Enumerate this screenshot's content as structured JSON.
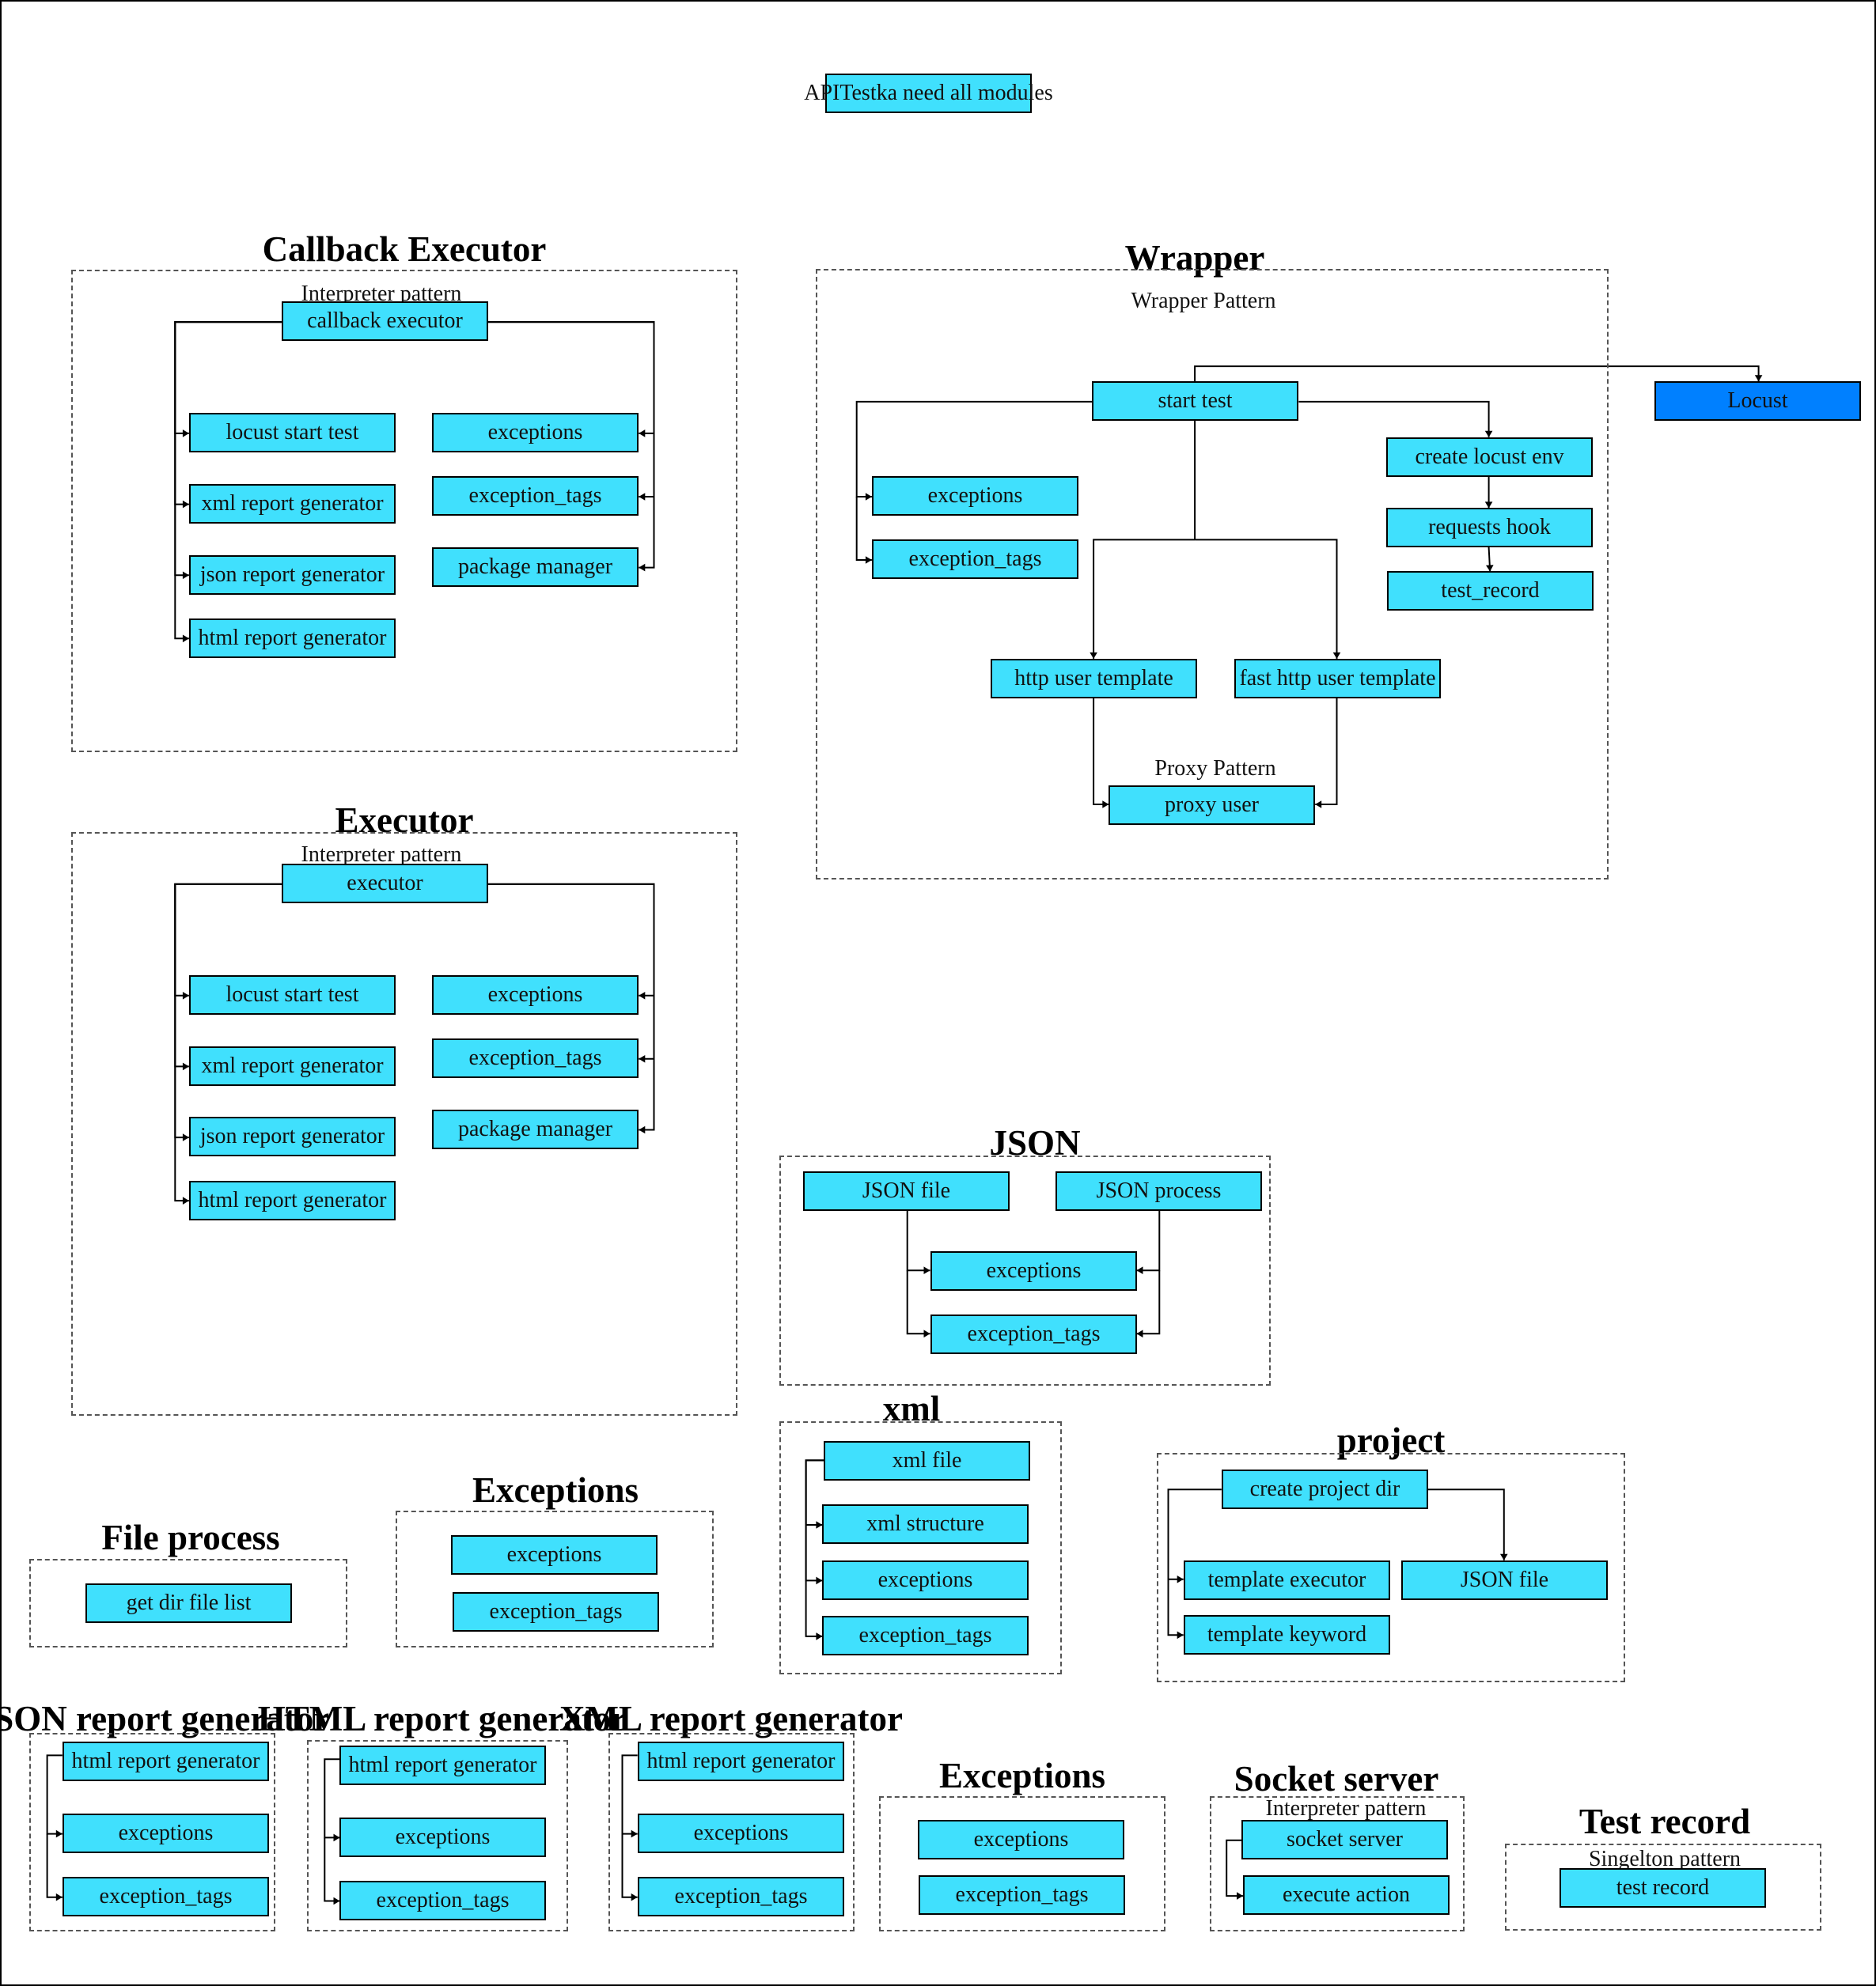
{
  "diagram": {
    "root_node": "APITestka need all modules",
    "colors": {
      "node_fill": "#40e0fd",
      "locust_fill": "#0080ff",
      "border": "#000000",
      "group_border": "#555555"
    },
    "sections": {
      "callback_executor": {
        "title": "Callback Executor",
        "pattern": "Interpreter pattern",
        "root": "callback executor",
        "left_children": [
          "locust start test",
          "xml report generator",
          "json report generator",
          "html report generator"
        ],
        "right_children": [
          "exceptions",
          "exception_tags",
          "package manager"
        ]
      },
      "wrapper": {
        "title": "Wrapper",
        "pattern": "Wrapper Pattern",
        "root": "start test",
        "external": "Locust",
        "left_children": [
          "exceptions",
          "exception_tags"
        ],
        "chain": [
          "create locust env",
          "requests hook",
          "test_record"
        ],
        "templates": [
          "http user template",
          "fast http user template"
        ],
        "proxy_pattern": "Proxy Pattern",
        "proxy": "proxy user"
      },
      "executor": {
        "title": "Executor",
        "pattern": "Interpreter pattern",
        "root": "executor",
        "left_children": [
          "locust start test",
          "xml report generator",
          "json report generator",
          "html report generator"
        ],
        "right_children": [
          "exceptions",
          "exception_tags",
          "package manager"
        ]
      },
      "json": {
        "title": "JSON",
        "sources": [
          "JSON file",
          "JSON process"
        ],
        "children": [
          "exceptions",
          "exception_tags"
        ]
      },
      "xml": {
        "title": "xml",
        "root": "xml file",
        "children": [
          "xml structure",
          "exceptions",
          "exception_tags"
        ]
      },
      "project": {
        "title": "project",
        "root": "create project dir",
        "left_children": [
          "template executor",
          "template keyword"
        ],
        "right_child": "JSON file"
      },
      "file_process": {
        "title": "File process",
        "items": [
          "get dir file list"
        ]
      },
      "exceptions_a": {
        "title": "Exceptions",
        "items": [
          "exceptions",
          "exception_tags"
        ]
      },
      "json_report": {
        "title": "JSON report generator",
        "root": "html report generator",
        "children": [
          "exceptions",
          "exception_tags"
        ]
      },
      "html_report": {
        "title": "HTML report generator",
        "root": "html report generator",
        "children": [
          "exceptions",
          "exception_tags"
        ]
      },
      "xml_report": {
        "title": "XML report generator",
        "root": "html report generator",
        "children": [
          "exceptions",
          "exception_tags"
        ]
      },
      "exceptions_b": {
        "title": "Exceptions",
        "items": [
          "exceptions",
          "exception_tags"
        ]
      },
      "socket_server": {
        "title": "Socket server",
        "pattern": "Interpreter pattern",
        "root": "socket server",
        "children": [
          "execute action"
        ]
      },
      "test_record": {
        "title": "Test record",
        "pattern": "Singelton pattern",
        "items": [
          "test record"
        ]
      }
    }
  }
}
